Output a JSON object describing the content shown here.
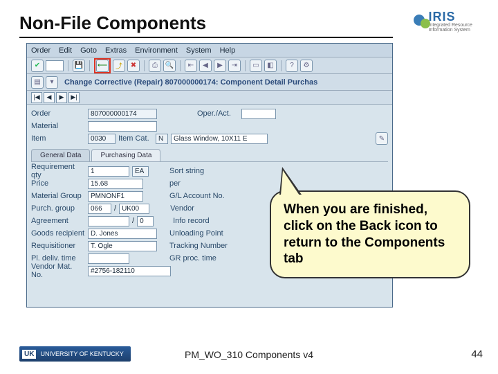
{
  "slide": {
    "title": "Non-File Components",
    "footer": "PM_WO_310 Components v4",
    "page": "44"
  },
  "logo": {
    "name": "IRIS",
    "sub": "Integrated Resource Information System"
  },
  "menu": {
    "m0": "Order",
    "m1": "Edit",
    "m2": "Goto",
    "m3": "Extras",
    "m4": "Environment",
    "m5": "System",
    "m6": "Help"
  },
  "win": {
    "title": "Change Corrective  (Repair) 807000000174: Component Detail Purchas"
  },
  "order_row": {
    "lbl": "Order",
    "val": "807000000174",
    "operact_lbl": "Oper./Act."
  },
  "mat_row": {
    "lbl": "Material"
  },
  "item_row": {
    "lbl": "Item",
    "val": "0030",
    "cat_lbl": "Item Cat.",
    "cat_val": "N",
    "desc": "Glass Window, 10X11 E"
  },
  "tabs": {
    "t0": "General Data",
    "t1": "Purchasing Data"
  },
  "pd": {
    "reqqty_lbl": "Requirement qty",
    "reqqty_val": "1",
    "reqqty_unit": "EA",
    "sort_lbl": "Sort string",
    "price_lbl": "Price",
    "price_val": "15.68",
    "per_lbl": "per",
    "matgrp_lbl": "Material Group",
    "matgrp_val": "PMNONF1",
    "glacct_lbl": "G/L Account No.",
    "purchgrp_lbl": "Purch. group",
    "purchgrp_val1": "066",
    "purchgrp_val2": "UK00",
    "vendor_lbl": "Vendor",
    "agr_lbl": "Agreement",
    "agr_sep": "/",
    "agr_val2": "0",
    "inforec_lbl": "Info record",
    "recipient_lbl": "Goods recipient",
    "recipient_val": "D. Jones",
    "unload_lbl": "Unloading Point",
    "req_lbl": "Requisitioner",
    "req_val": "T. Ogle",
    "track_lbl": "Tracking Number",
    "pldel_lbl": "Pl. deliv. time",
    "grproc_lbl": "GR proc. time",
    "vmat_lbl": "Vendor Mat. No.",
    "vmat_val": "#2756-182110"
  },
  "callout": {
    "text": "When you are finished, click on the Back icon to return to the Components tab"
  },
  "uk": {
    "mark": "UK",
    "name": "UNIVERSITY OF KENTUCKY"
  }
}
